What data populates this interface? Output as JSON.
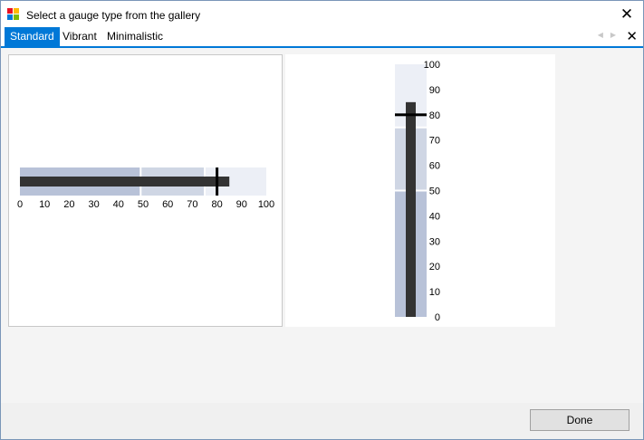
{
  "window": {
    "title": "Select a gauge type from the gallery",
    "app_icon": "app-windows-icon",
    "close_glyph": "✕"
  },
  "tabs": [
    {
      "label": "Standard",
      "active": true
    },
    {
      "label": "Vibrant",
      "active": false
    },
    {
      "label": "Minimalistic",
      "active": false
    }
  ],
  "tab_nav": {
    "prev_glyph": "◀",
    "next_glyph": "▶",
    "close_glyph": "✕"
  },
  "colors": {
    "accent": "#0078d7",
    "range_dark": "#b8c2d8",
    "range_mid": "#cfd6e4",
    "range_light": "#eceff6",
    "bar": "#333333",
    "marker": "#000000"
  },
  "gauges": [
    {
      "orientation": "horizontal",
      "min": 0,
      "max": 100,
      "ticks": [
        0,
        10,
        20,
        30,
        40,
        50,
        60,
        70,
        80,
        90,
        100
      ],
      "ranges": [
        [
          0,
          49
        ],
        [
          49,
          75
        ],
        [
          75,
          100
        ]
      ],
      "value": 85,
      "target": 80
    },
    {
      "orientation": "vertical",
      "min": 0,
      "max": 100,
      "ticks": [
        0,
        10,
        20,
        30,
        40,
        50,
        60,
        70,
        80,
        90,
        100
      ],
      "ranges": [
        [
          0,
          50
        ],
        [
          50,
          75
        ],
        [
          75,
          100
        ]
      ],
      "value": 85,
      "target": 80
    }
  ],
  "footer": {
    "done_label": "Done"
  }
}
